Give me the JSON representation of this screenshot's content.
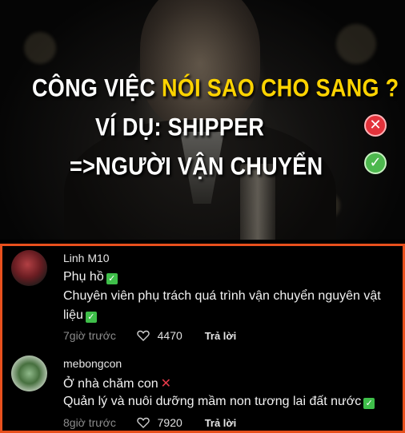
{
  "meme": {
    "line1_white": "CÔNG VIỆC ",
    "line1_yellow": "NÓI SAO CHO SANG ?",
    "line2": "VÍ DỤ: SHIPPER",
    "line3": "=>NGƯỜI VẬN CHUYỂN",
    "wrong_icon": "x-icon",
    "right_icon": "check-icon"
  },
  "comments": [
    {
      "username": "Linh M10",
      "lines": [
        "Phụ hồ",
        "Chuyên viên phụ trách quá trình vận chuyển nguyên vật",
        "liệu"
      ],
      "time": "7giờ trước",
      "likes": "4470",
      "reply": "Trả lời"
    },
    {
      "username": "mebongcon",
      "lines": [
        "Ở nhà chăm con",
        "Quản lý và nuôi dưỡng mầm non tương lai đất nước"
      ],
      "time": "8giờ trước",
      "likes": "7920",
      "reply": "Trả lời"
    }
  ],
  "colors": {
    "highlight": "#ffd400",
    "border": "#e8501d",
    "check": "#3fbf4a",
    "cross": "#e83a4a"
  }
}
